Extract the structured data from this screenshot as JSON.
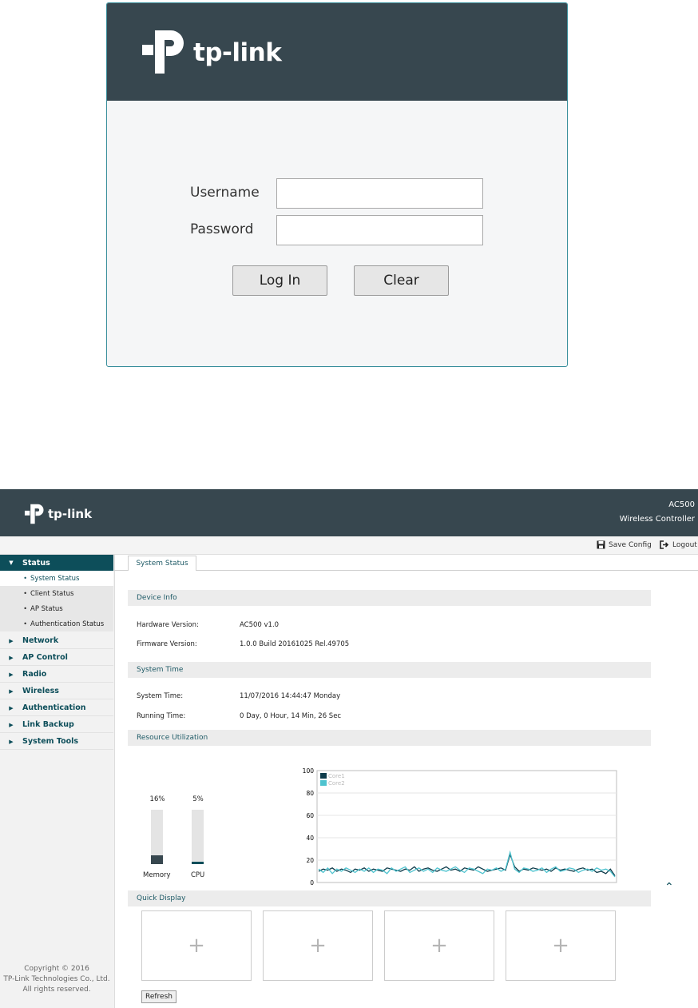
{
  "login": {
    "brand": "tp-link",
    "username_label": "Username",
    "password_label": "Password",
    "username_value": "",
    "password_value": "",
    "login_button": "Log In",
    "clear_button": "Clear"
  },
  "header": {
    "brand": "tp-link",
    "model": "AC500",
    "product": "Wireless Controller"
  },
  "toolbar": {
    "save_config": "Save Config",
    "logout": "Logout",
    "save_icon": "save-icon",
    "logout_icon": "logout-icon"
  },
  "sidebar": {
    "items": [
      {
        "label": "Status",
        "expanded": true,
        "active": true,
        "children": [
          "System Status",
          "Client Status",
          "AP Status",
          "Authentication Status"
        ]
      },
      {
        "label": "Network"
      },
      {
        "label": "AP Control"
      },
      {
        "label": "Radio"
      },
      {
        "label": "Wireless"
      },
      {
        "label": "Authentication"
      },
      {
        "label": "Link Backup"
      },
      {
        "label": "System Tools"
      }
    ],
    "copyright": [
      "Copyright © 2016",
      "TP-Link Technologies Co., Ltd.",
      "All rights reserved."
    ]
  },
  "tabs": {
    "active": "System Status"
  },
  "device_info": {
    "title": "Device Info",
    "hardware_label": "Hardware Version:",
    "hardware_value": "AC500 v1.0",
    "firmware_label": "Firmware Version:",
    "firmware_value": "1.0.0 Build 20161025 Rel.49705"
  },
  "system_time": {
    "title": "System Time",
    "time_label": "System Time:",
    "time_value": "11/07/2016 14:44:47 Monday",
    "running_label": "Running Time:",
    "running_value": "0 Day, 0 Hour, 14 Min, 26 Sec"
  },
  "resource": {
    "title": "Resource Utilization",
    "memory_label": "Memory",
    "memory_percent": "16%",
    "memory_value": 16,
    "cpu_label": "CPU",
    "cpu_percent": "5%",
    "cpu_value": 5
  },
  "chart_data": {
    "type": "line",
    "title": "",
    "xlabel": "",
    "ylabel": "",
    "ylim": [
      0,
      100
    ],
    "yticks": [
      0,
      20,
      40,
      60,
      80,
      100
    ],
    "grid": true,
    "legend": "top-left",
    "series": [
      {
        "name": "Core1",
        "color": "#0d3b4a",
        "values": [
          10,
          12,
          11,
          13,
          10,
          12,
          11,
          9,
          12,
          11,
          13,
          10,
          12,
          11,
          10,
          13,
          12,
          11,
          10,
          12,
          11,
          14,
          10,
          12,
          13,
          11,
          10,
          12,
          14,
          11,
          12,
          10,
          13,
          12,
          11,
          14,
          12,
          10,
          11,
          12,
          13,
          11,
          25,
          14,
          10,
          12,
          11,
          13,
          12,
          11,
          12,
          10,
          13,
          11,
          12,
          11,
          10,
          12,
          13,
          11,
          12,
          9,
          10,
          8,
          12,
          6
        ]
      },
      {
        "name": "Core2",
        "color": "#4fc3cf",
        "values": [
          12,
          9,
          13,
          8,
          12,
          10,
          13,
          11,
          9,
          12,
          10,
          13,
          9,
          12,
          11,
          8,
          13,
          10,
          12,
          14,
          9,
          11,
          13,
          10,
          12,
          9,
          13,
          11,
          10,
          12,
          14,
          11,
          9,
          13,
          12,
          10,
          8,
          12,
          11,
          13,
          10,
          12,
          27,
          12,
          9,
          13,
          12,
          10,
          11,
          13,
          9,
          12,
          14,
          10,
          11,
          13,
          12,
          9,
          11,
          12,
          10,
          13,
          11,
          12,
          10,
          5
        ]
      }
    ]
  },
  "quick_display": {
    "title": "Quick Display",
    "boxes": [
      "+",
      "+",
      "+",
      "+"
    ],
    "refresh": "Refresh"
  },
  "scroll_top_glyph": "⌃"
}
